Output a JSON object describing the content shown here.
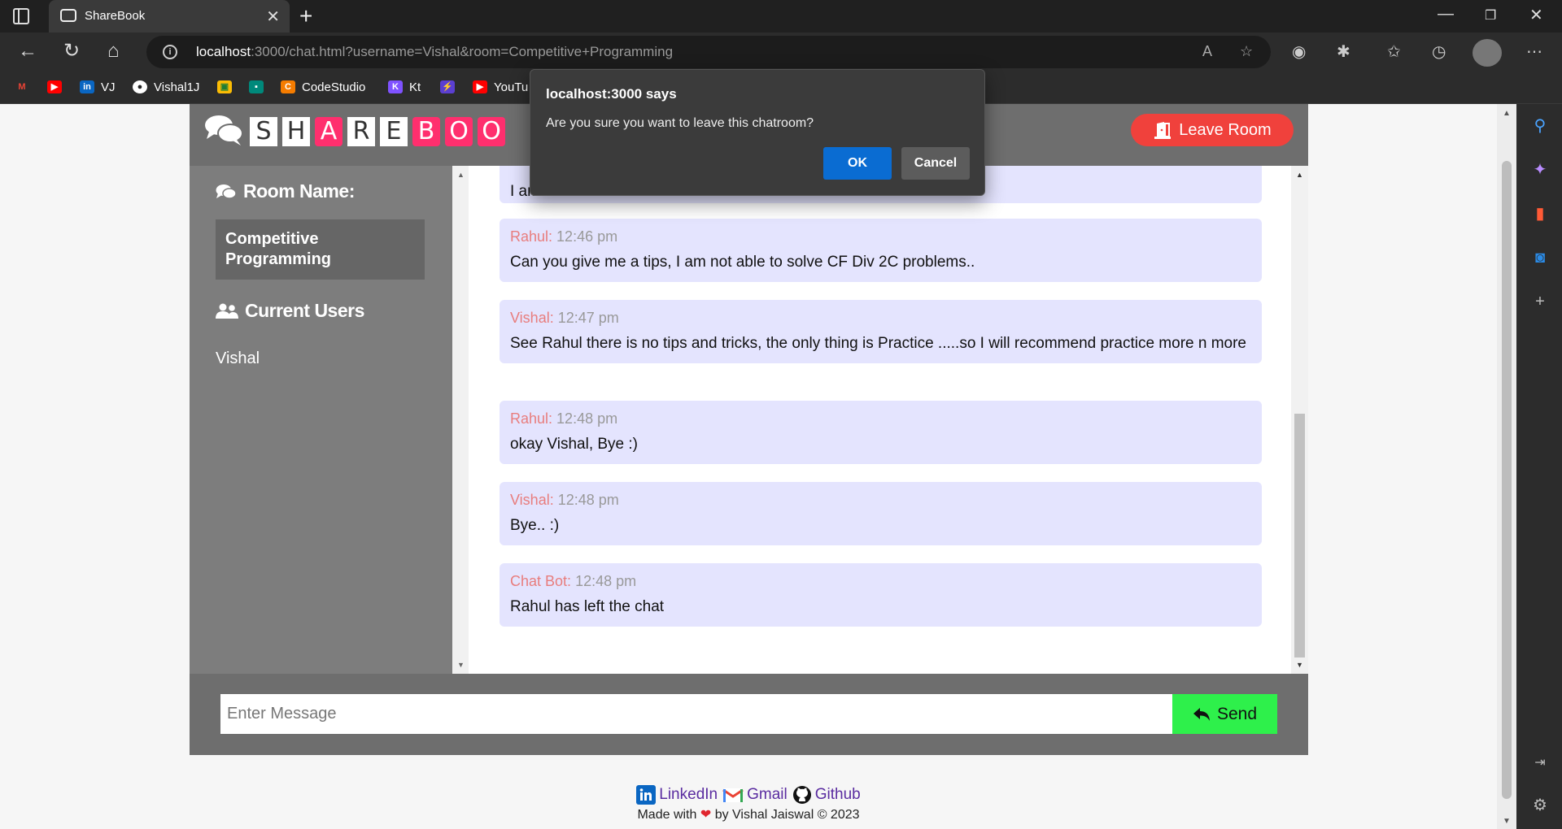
{
  "browser": {
    "tab_title": "ShareBook",
    "url_host": "localhost",
    "url_rest": ":3000/chat.html?username=Vishal&room=Competitive+Programming",
    "bookmarks": [
      {
        "label": "",
        "icon": "gmail-icon",
        "color": "#ea4335"
      },
      {
        "label": "",
        "icon": "youtube-icon",
        "color": "#ff0000"
      },
      {
        "label": "VJ",
        "icon": "linkedin-icon",
        "color": "#0a66c2"
      },
      {
        "label": "Vishal1J",
        "icon": "github-icon",
        "color": "#ffffff"
      },
      {
        "label": "",
        "icon": "classroom-icon",
        "color": "#fbbc04"
      },
      {
        "label": "",
        "icon": "meet-icon",
        "color": "#00897b"
      },
      {
        "label": "CodeStudio",
        "icon": "codestudio-icon",
        "color": "#f57c00"
      },
      {
        "label": "Kt",
        "icon": "kotlin-icon",
        "color": "#7f52ff"
      },
      {
        "label": "",
        "icon": "bolt-icon",
        "color": "#5b3fd1"
      },
      {
        "label": "YouTu",
        "icon": "youtube-icon",
        "color": "#ff0000"
      }
    ]
  },
  "app": {
    "logo_letters": [
      {
        "ch": "S",
        "style": "w"
      },
      {
        "ch": "H",
        "style": "w"
      },
      {
        "ch": "A",
        "style": "p"
      },
      {
        "ch": "R",
        "style": "w"
      },
      {
        "ch": "E",
        "style": "w"
      },
      {
        "ch": "B",
        "style": "p"
      },
      {
        "ch": "O",
        "style": "p"
      },
      {
        "ch": "O",
        "style": "p"
      }
    ],
    "leave_label": "Leave Room",
    "room_heading": "Room Name:",
    "room_name": "Competitive Programming",
    "users_heading": "Current Users",
    "users": [
      "Vishal"
    ],
    "messages": [
      {
        "user": "",
        "time": "",
        "text": "I am"
      },
      {
        "user": "Rahul:",
        "time": "12:46 pm",
        "text": "Can you give me a tips, I am not able to solve CF Div 2C problems.."
      },
      {
        "user": "Vishal:",
        "time": "12:47 pm",
        "text": "See Rahul there is no tips and tricks, the only thing is Practice .....so I will recommend practice more n more"
      },
      {
        "user": "Rahul:",
        "time": "12:48 pm",
        "text": "okay Vishal, Bye :)"
      },
      {
        "user": "Vishal:",
        "time": "12:48 pm",
        "text": "Bye.. :)"
      },
      {
        "user": "Chat Bot:",
        "time": "12:48 pm",
        "text": "Rahul has left the chat"
      }
    ],
    "input_placeholder": "Enter Message",
    "send_label": "Send",
    "footer": {
      "linkedin": "LinkedIn",
      "gmail": "Gmail",
      "github": "Github",
      "credit_pre": "Made with",
      "credit_post": "by Vishal Jaiswal © 2023"
    }
  },
  "dialog": {
    "title": "localhost:3000 says",
    "message": "Are you sure you want to leave this chatroom?",
    "ok": "OK",
    "cancel": "Cancel"
  },
  "colors": {
    "accent_pink": "#ff2f6e",
    "leave_red": "#f0413c",
    "send_green": "#2ef04b",
    "message_bg": "#e4e4fe",
    "dialog_ok": "#0a6cd2"
  }
}
